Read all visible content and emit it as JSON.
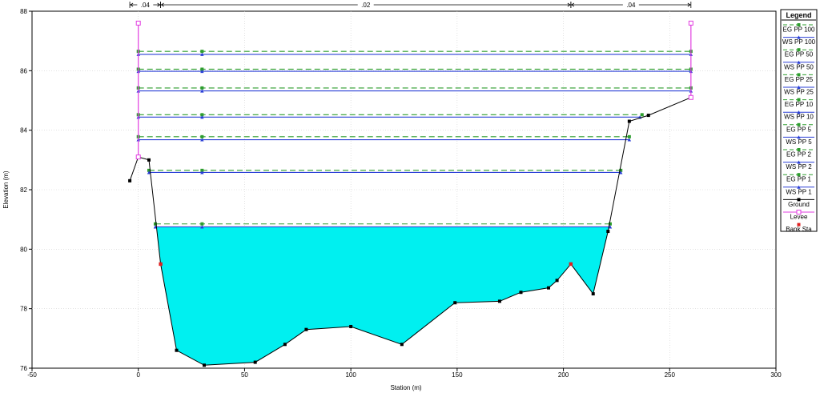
{
  "chart_data": {
    "type": "line",
    "xlabel": "Station (m)",
    "ylabel": "Elevation (m)",
    "xlim": [
      -50,
      300
    ],
    "ylim": [
      76,
      88
    ],
    "x_ticks": [
      -50,
      0,
      50,
      100,
      150,
      200,
      250,
      300
    ],
    "y_ticks": [
      76,
      78,
      80,
      82,
      84,
      86,
      88
    ],
    "x_tick_labels": [
      "-50",
      "0",
      "50",
      "100",
      "150",
      "200",
      "250",
      "300"
    ],
    "y_tick_labels": [
      "76",
      "78",
      "80",
      "82",
      "84",
      "86",
      "88"
    ],
    "mannings_n": [
      {
        "label": ".04",
        "x_from": -4,
        "x_to": 10.5
      },
      {
        "label": ".02",
        "x_from": 10.5,
        "x_to": 203.5
      },
      {
        "label": ".04",
        "x_from": 203.5,
        "x_to": 260
      }
    ],
    "ground": {
      "x": [
        -4,
        0,
        5,
        10.5,
        18,
        31,
        55,
        69,
        79,
        100,
        124,
        149,
        170,
        180,
        193,
        197,
        203.5,
        214,
        221,
        231,
        240,
        260
      ],
      "y": [
        82.3,
        83.1,
        83.0,
        79.5,
        76.6,
        76.1,
        76.2,
        76.8,
        77.3,
        77.4,
        76.8,
        78.2,
        78.25,
        78.55,
        78.7,
        78.95,
        79.5,
        78.5,
        80.6,
        84.3,
        84.5,
        85.1
      ]
    },
    "bank_stations": [
      {
        "x": 10.5,
        "y": 79.5
      },
      {
        "x": 203.5,
        "y": 79.5
      }
    ],
    "levees": [
      {
        "x": 0,
        "y_bottom": 83.1,
        "y_top": 87.6
      },
      {
        "x": 260,
        "y_bottom": 85.1,
        "y_top": 87.6
      }
    ],
    "profiles": [
      {
        "name": "EG PP 100",
        "kind": "EG",
        "elev": 86.65,
        "x_from": 0,
        "x_to": 260
      },
      {
        "name": "WS PP 100",
        "kind": "WS",
        "elev": 86.55,
        "x_from": 0,
        "x_to": 260
      },
      {
        "name": "EG PP 50",
        "kind": "EG",
        "elev": 86.05,
        "x_from": 0,
        "x_to": 260
      },
      {
        "name": "WS PP 50",
        "kind": "WS",
        "elev": 85.98,
        "x_from": 0,
        "x_to": 260
      },
      {
        "name": "EG PP 25",
        "kind": "EG",
        "elev": 85.42,
        "x_from": 0,
        "x_to": 260
      },
      {
        "name": "WS PP 25",
        "kind": "WS",
        "elev": 85.32,
        "x_from": 0,
        "x_to": 260
      },
      {
        "name": "EG PP 10",
        "kind": "EG",
        "elev": 84.52,
        "x_from": 0,
        "x_to": 237
      },
      {
        "name": "WS PP 10",
        "kind": "WS",
        "elev": 84.44,
        "x_from": 0,
        "x_to": 236
      },
      {
        "name": "EG PP 5",
        "kind": "EG",
        "elev": 83.78,
        "x_from": 0,
        "x_to": 231
      },
      {
        "name": "WS PP 5",
        "kind": "WS",
        "elev": 83.68,
        "x_from": 0,
        "x_to": 231
      },
      {
        "name": "EG PP 2",
        "kind": "EG",
        "elev": 82.65,
        "x_from": 5,
        "x_to": 227
      },
      {
        "name": "WS PP 2",
        "kind": "WS",
        "elev": 82.58,
        "x_from": 5,
        "x_to": 227
      },
      {
        "name": "EG PP 1",
        "kind": "EG",
        "elev": 80.85,
        "x_from": 8,
        "x_to": 222
      },
      {
        "name": "WS PP 1",
        "kind": "WS",
        "elev": 80.75,
        "x_from": 8,
        "x_to": 222
      }
    ],
    "water_fill_profile": "WS PP 1",
    "legend": {
      "title": "Legend",
      "entries": [
        "EG PP 100",
        "WS PP 100",
        "EG PP 50",
        "WS PP 50",
        "EG PP 25",
        "WS PP 25",
        "EG PP 10",
        "WS PP 10",
        "EG PP 5",
        "WS PP 5",
        "EG PP 2",
        "WS PP 2",
        "EG PP 1",
        "WS PP 1",
        "Ground",
        "Levee",
        "Bank Sta"
      ],
      "placement": "right"
    },
    "colors": {
      "eg": "#2e9e2e",
      "ws": "#2a3fd6",
      "ground": "#000000",
      "levee": "#e23ee0",
      "bank": "#e02020",
      "water": "#00f0f0",
      "grid": "#cfcfcf"
    },
    "grid": true
  }
}
